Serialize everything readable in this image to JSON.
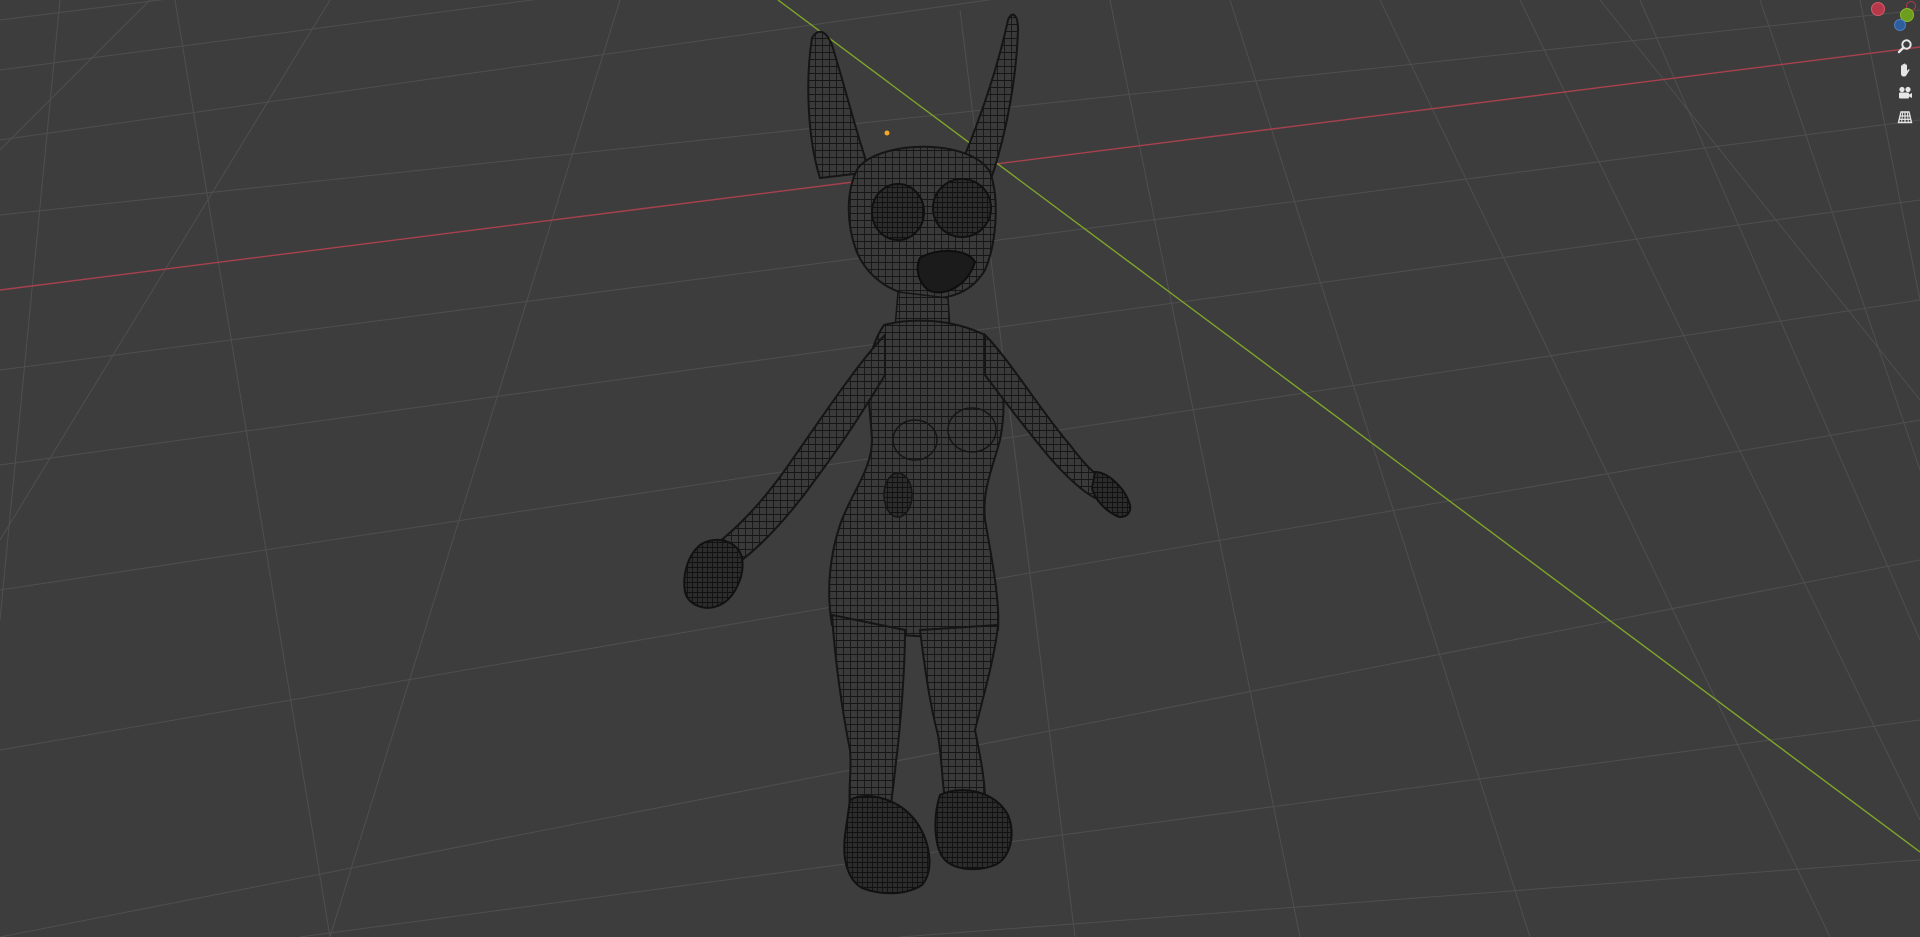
{
  "viewport": {
    "background": "#3d3d3d",
    "grid_color": "#4f4f4f",
    "x_axis_color": "#a8414e",
    "y_axis_color": "#7fa52a",
    "wire_color": "#141414"
  },
  "navigation": {
    "gizmo": {
      "x_color": "#b5394a",
      "y_color": "#6d9c1f",
      "z_color": "#2e5f9c"
    },
    "tools": [
      {
        "name": "zoom",
        "icon": "magnifier-icon"
      },
      {
        "name": "pan",
        "icon": "hand-icon"
      },
      {
        "name": "camera",
        "icon": "camera-icon"
      },
      {
        "name": "perspective",
        "icon": "grid-perspective-icon"
      }
    ]
  }
}
